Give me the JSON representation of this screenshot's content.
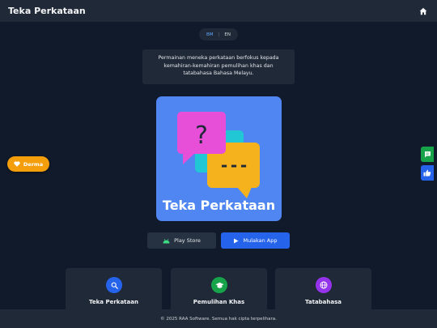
{
  "header": {
    "title": "Teka Perkataan",
    "home_icon": "home-icon"
  },
  "language": {
    "bm": "BM",
    "separator": "|",
    "en": "EN",
    "active": "BM"
  },
  "description": "Permainan meneka perkataan berfokus kepada kemahiran-kemahiran pemulihan khas dan tatabahasa Bahasa Melayu.",
  "logo": {
    "text": "Teka Perkataan",
    "question_mark": "?",
    "dashes": "---"
  },
  "buttons": {
    "play_store": "Play Store",
    "launch_app": "Mulakan App"
  },
  "donate": {
    "label": "Derma",
    "icon": "heart-icon"
  },
  "side_buttons": {
    "feedback_icon": "chat-icon",
    "like_icon": "thumbs-up-icon"
  },
  "cards": [
    {
      "title": "Teka Perkataan",
      "icon": "search-icon",
      "color": "#2563eb"
    },
    {
      "title": "Pemulihan Khas",
      "icon": "graduation-cap-icon",
      "color": "#16a34a"
    },
    {
      "title": "Tatabahasa",
      "icon": "globe-icon",
      "color": "#9333ea"
    }
  ],
  "footer": {
    "text": "© 2025 RAA Software. Semua hak cipta terpelihara."
  },
  "colors": {
    "background": "#111a2b",
    "panel": "#1f2937",
    "accent": "#2563eb",
    "donate": "#f59e0b",
    "logo_bg": "#4f86f2"
  }
}
